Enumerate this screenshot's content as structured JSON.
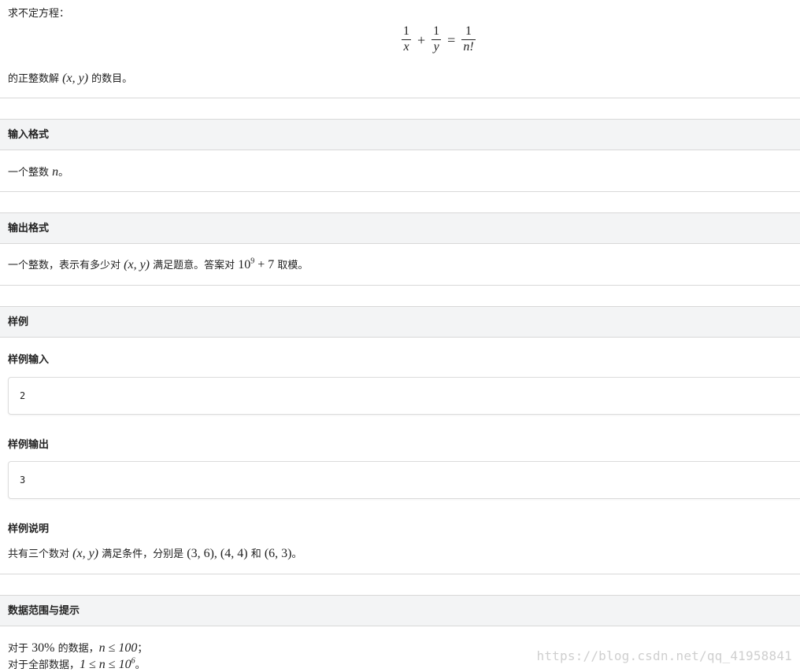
{
  "intro": {
    "line1": "求不定方程：",
    "line2_prefix": "的正整数解",
    "line2_math": "(x, y)",
    "line2_suffix": "的数目。"
  },
  "equation": {
    "lhs1_num": "1",
    "lhs1_den": "x",
    "plus": "+",
    "lhs2_num": "1",
    "lhs2_den": "y",
    "equals": "=",
    "rhs_num": "1",
    "rhs_den": "n!"
  },
  "sections": {
    "input": {
      "title": "输入格式",
      "text_prefix": "一个整数 ",
      "text_math": "n",
      "text_suffix": "。"
    },
    "output": {
      "title": "输出格式",
      "text_prefix": "一个整数，表示有多少对 ",
      "text_math1": "(x, y)",
      "text_mid": " 满足题意。答案对 ",
      "text_math2_base": "10",
      "text_math2_exp": "9",
      "text_math2_rest": " + 7",
      "text_suffix": " 取模。"
    },
    "sample": {
      "title": "样例",
      "input_label": "样例输入",
      "input_value": "2",
      "output_label": "样例输出",
      "output_value": "3",
      "explain_label": "样例说明",
      "explain_prefix": "共有三个数对 ",
      "explain_math1": "(x, y)",
      "explain_mid": " 满足条件，分别是 ",
      "explain_math2": "(3, 6), (4, 4)",
      "explain_and": " 和 ",
      "explain_math3": "(6, 3)",
      "explain_suffix": "。"
    },
    "range": {
      "title": "数据范围与提示",
      "line1_prefix": "对于 ",
      "line1_math1": "30%",
      "line1_mid": " 的数据，",
      "line1_math2": "n ≤ 100",
      "line1_suffix": "；",
      "line2_prefix": "对于全部数据，",
      "line2_math_base": "1 ≤ n ≤ 10",
      "line2_math_exp": "6",
      "line2_suffix": "。"
    }
  },
  "watermark": "https://blog.csdn.net/qq_41958841"
}
